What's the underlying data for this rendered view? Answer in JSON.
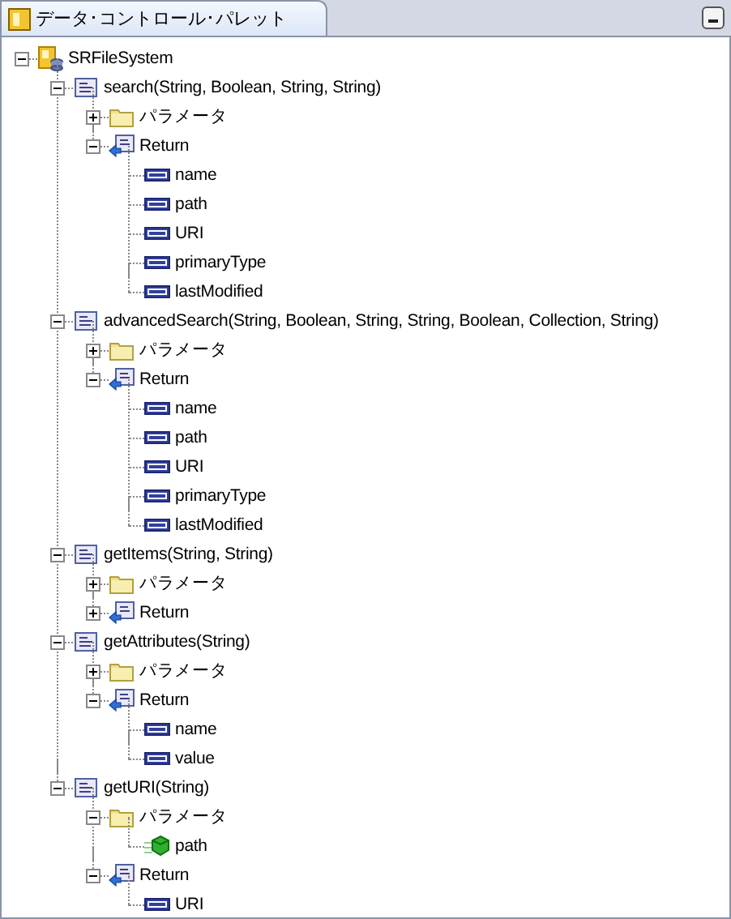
{
  "panel": {
    "title": "データ･コントロール･パレット"
  },
  "tree": [
    {
      "kind": "root",
      "label": "SRFileSystem",
      "expanded": true,
      "children": [
        {
          "kind": "method",
          "label": "search(String, Boolean, String, String)",
          "expanded": true,
          "children": [
            {
              "kind": "folder",
              "label": "パラメータ",
              "expanded": false
            },
            {
              "kind": "return",
              "label": "Return",
              "expanded": true,
              "children": [
                {
                  "kind": "field",
                  "label": "name"
                },
                {
                  "kind": "field",
                  "label": "path"
                },
                {
                  "kind": "field",
                  "label": "URI"
                },
                {
                  "kind": "field",
                  "label": "primaryType"
                },
                {
                  "kind": "field",
                  "label": "lastModified"
                }
              ]
            }
          ]
        },
        {
          "kind": "method",
          "label": "advancedSearch(String, Boolean, String, String, Boolean, Collection, String)",
          "expanded": true,
          "children": [
            {
              "kind": "folder",
              "label": "パラメータ",
              "expanded": false
            },
            {
              "kind": "return",
              "label": "Return",
              "expanded": true,
              "children": [
                {
                  "kind": "field",
                  "label": "name"
                },
                {
                  "kind": "field",
                  "label": "path"
                },
                {
                  "kind": "field",
                  "label": "URI"
                },
                {
                  "kind": "field",
                  "label": "primaryType"
                },
                {
                  "kind": "field",
                  "label": "lastModified"
                }
              ]
            }
          ]
        },
        {
          "kind": "method",
          "label": "getItems(String, String)",
          "expanded": true,
          "children": [
            {
              "kind": "folder",
              "label": "パラメータ",
              "expanded": false
            },
            {
              "kind": "return",
              "label": "Return",
              "expanded": false
            }
          ]
        },
        {
          "kind": "method",
          "label": "getAttributes(String)",
          "expanded": true,
          "children": [
            {
              "kind": "folder",
              "label": "パラメータ",
              "expanded": false
            },
            {
              "kind": "return",
              "label": "Return",
              "expanded": true,
              "children": [
                {
                  "kind": "field",
                  "label": "name"
                },
                {
                  "kind": "field",
                  "label": "value"
                }
              ]
            }
          ]
        },
        {
          "kind": "method",
          "label": "getURI(String)",
          "expanded": true,
          "children": [
            {
              "kind": "folder",
              "label": "パラメータ",
              "expanded": true,
              "children": [
                {
                  "kind": "param",
                  "label": "path"
                }
              ]
            },
            {
              "kind": "return",
              "label": "Return",
              "expanded": true,
              "children": [
                {
                  "kind": "field",
                  "label": "URI"
                }
              ]
            }
          ]
        }
      ]
    }
  ]
}
